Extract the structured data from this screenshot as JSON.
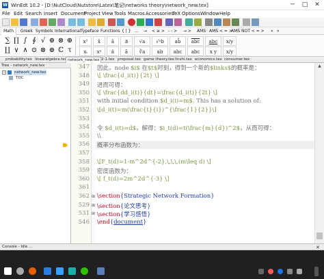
{
  "window": {
    "title": "WinEdt 10.2 - [D:\\NutCloud\\Nutstore\\Latex\\笔记\\networks theory\\network_new.tex]",
    "minimize": "─",
    "maximize": "□",
    "close": "✕"
  },
  "menu": [
    "File",
    "Edit",
    "Search",
    "Insert",
    "Document",
    "Project",
    "View",
    "Tools",
    "Macros",
    "Accessories",
    "TeX",
    "Options",
    "Window",
    "Help"
  ],
  "symbol_tabs": [
    "Math",
    "Greek",
    "Symbols",
    "International",
    "Typeface",
    "Functions",
    "{ | }",
    "...",
    "→",
    "< ≥ >",
    "- - >",
    "→ >",
    "AMS",
    "AMS < = >",
    "AMS NOT < = >",
    "«",
    "»"
  ],
  "symbols_row1": [
    "∑",
    "∏",
    "∫",
    "∮",
    "√",
    "⊕",
    "⊗",
    "⊕"
  ],
  "symbols_row2": [
    "∐",
    "∨",
    "∧",
    "⊙",
    "⊗",
    "⊕",
    "ℂ",
    "τ"
  ],
  "symbol_boxes_row1": [
    "x²",
    "x̄",
    "ā",
    "a⃗",
    "√a",
    "√ᵃb",
    "ab̂",
    "abc",
    "abc",
    "x/y"
  ],
  "symbol_boxes_row2": [
    "xᵢ",
    "xᵃ",
    "ä",
    "ã",
    "∛a",
    "ab",
    "abc",
    "abc",
    "x y",
    "x/y"
  ],
  "file_tabs": [
    "probability.tex",
    "linearalgebra.tex",
    "network_new.tex",
    "2-1.tex",
    "proposal.tex",
    "game theory.tex",
    "linshi.tex",
    "economics.tex",
    "consumer.tex"
  ],
  "active_tab": "network_new.tex",
  "tree": {
    "header": "Tree - network_new.tex",
    "items": [
      "network_new.tex",
      "TOC"
    ]
  },
  "editor": {
    "lines": [
      {
        "num": "347",
        "segments": [
          {
            "t": "因此，node ",
            "c": ""
          },
          {
            "t": "$i$",
            "c": "grn"
          },
          {
            "t": " 在",
            "c": ""
          },
          {
            "t": "$t$",
            "c": "grn"
          },
          {
            "t": "时刻，得到一个新的",
            "c": ""
          },
          {
            "t": "$links$",
            "c": "grn"
          },
          {
            "t": "的概率是：",
            "c": ""
          }
        ]
      },
      {
        "num": "348",
        "segments": [
          {
            "t": "\\[ \\frac{d_i(t)}{2t} \\]",
            "c": "grn"
          }
        ]
      },
      {
        "num": "349",
        "segments": [
          {
            "t": "进而可得：",
            "c": ""
          }
        ]
      },
      {
        "num": "350",
        "segments": [
          {
            "t": "\\[ \\frac{dd_i(t)}{dt}=\\frac{d_i(t)}{2t} \\]",
            "c": "grn"
          }
        ]
      },
      {
        "num": "351",
        "segments": [
          {
            "t": "with initial condition ",
            "c": ""
          },
          {
            "t": "$d_i(i)=m$",
            "c": "grn"
          },
          {
            "t": ". This has a solution of:",
            "c": ""
          }
        ]
      },
      {
        "num": "352",
        "segments": [
          {
            "t": "\\[d_i(t)=m(\\frac{t}{i})^{\\frac{1}{2}}\\]",
            "c": "grn"
          }
        ]
      },
      {
        "num": "353",
        "segments": [
          {
            "t": "",
            "c": ""
          }
        ]
      },
      {
        "num": "354",
        "segments": [
          {
            "t": "令 ",
            "c": ""
          },
          {
            "t": "$d_i(t)=d$",
            "c": "grn"
          },
          {
            "t": "，解得：",
            "c": ""
          },
          {
            "t": "$i_t(d)=t(\\frac{m}{d})^2$",
            "c": "grn"
          },
          {
            "t": "，从而可得：",
            "c": ""
          }
        ]
      },
      {
        "num": "355",
        "segments": [
          {
            "t": "\\\\",
            "c": ""
          }
        ]
      },
      {
        "num": "356",
        "segments": [
          {
            "t": "概率分布函数为：",
            "c": ""
          }
        ]
      },
      {
        "num": "357",
        "segments": [
          {
            "t": "",
            "c": ""
          }
        ]
      },
      {
        "num": "358",
        "segments": [
          {
            "t": "\\[F_t(d)=1-m^2d^{-2},\\,\\,\\,(m\\leq d) \\]",
            "c": "grn"
          }
        ]
      },
      {
        "num": "359",
        "segments": [
          {
            "t": "密度函数为：",
            "c": ""
          }
        ]
      },
      {
        "num": "360",
        "segments": [
          {
            "t": "\\[ f_t(d)=2m^2d^{-3} \\]",
            "c": "grn"
          }
        ]
      },
      {
        "num": "361",
        "segments": [
          {
            "t": "",
            "c": ""
          }
        ]
      },
      {
        "num": "362",
        "segments": [
          {
            "t": "\\section",
            "c": "red"
          },
          {
            "t": "{Strategic Network Formation}",
            "c": "blu"
          }
        ]
      },
      {
        "num": "529",
        "segments": [
          {
            "t": "\\section",
            "c": "red"
          },
          {
            "t": "{论文思考}",
            "c": "blu"
          }
        ]
      },
      {
        "num": "531",
        "segments": [
          {
            "t": "\\section",
            "c": "red"
          },
          {
            "t": "{学习感悟}",
            "c": "blu"
          }
        ]
      },
      {
        "num": "546",
        "segments": [
          {
            "t": "\\end",
            "c": "red"
          },
          {
            "t": "{",
            "c": "blu"
          },
          {
            "t": "document",
            "c": "blu und"
          },
          {
            "t": "}",
            "c": "blu"
          }
        ]
      }
    ],
    "current_line": "356",
    "fold_markers": [
      "362",
      "529",
      "531"
    ]
  },
  "console": {
    "title": "Console - Idle ..."
  },
  "colors": {
    "accent": "#1b5aa3",
    "taskbar": "#202023",
    "math_text": "#7a9440",
    "command": "#c00020",
    "argument": "#1d3aa8"
  }
}
